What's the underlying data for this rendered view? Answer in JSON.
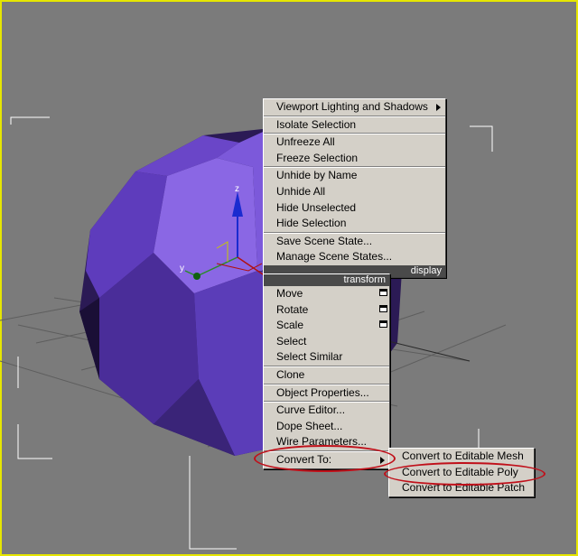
{
  "top_menu": {
    "items": [
      {
        "label": "Viewport Lighting and Shadows",
        "submenu": true
      },
      {
        "label": "Isolate Selection"
      },
      {
        "label": "Unfreeze All"
      },
      {
        "label": "Freeze Selection"
      },
      {
        "label": "Unhide by Name"
      },
      {
        "label": "Unhide All"
      },
      {
        "label": "Hide Unselected"
      },
      {
        "label": "Hide Selection"
      },
      {
        "label": "Save Scene State..."
      },
      {
        "label": "Manage Scene States..."
      }
    ],
    "quad_label": "display"
  },
  "bottom_menu": {
    "quad_label": "transform",
    "items": [
      {
        "label": "Move",
        "settings_box": true
      },
      {
        "label": "Rotate",
        "settings_box": true
      },
      {
        "label": "Scale",
        "settings_box": true
      },
      {
        "label": "Select"
      },
      {
        "label": "Select Similar"
      },
      {
        "label": "Clone"
      },
      {
        "label": "Object Properties..."
      },
      {
        "label": "Curve Editor..."
      },
      {
        "label": "Dope Sheet..."
      },
      {
        "label": "Wire Parameters..."
      },
      {
        "label": "Convert To:",
        "submenu": true,
        "highlighted": true
      }
    ]
  },
  "submenu": {
    "items": [
      {
        "label": "Convert to Editable Mesh"
      },
      {
        "label": "Convert to Editable Poly",
        "highlighted": true
      },
      {
        "label": "Convert to Editable Patch"
      }
    ]
  },
  "gizmo": {
    "z_axis_label": "z",
    "y_axis_label": "y"
  },
  "colors": {
    "viewport_border": "#e6e600",
    "menu_background": "#d4d0c8",
    "quad_label_background": "#4a4a4a",
    "object_purple": "#7a55d6",
    "annotation_red": "#c0101a"
  }
}
